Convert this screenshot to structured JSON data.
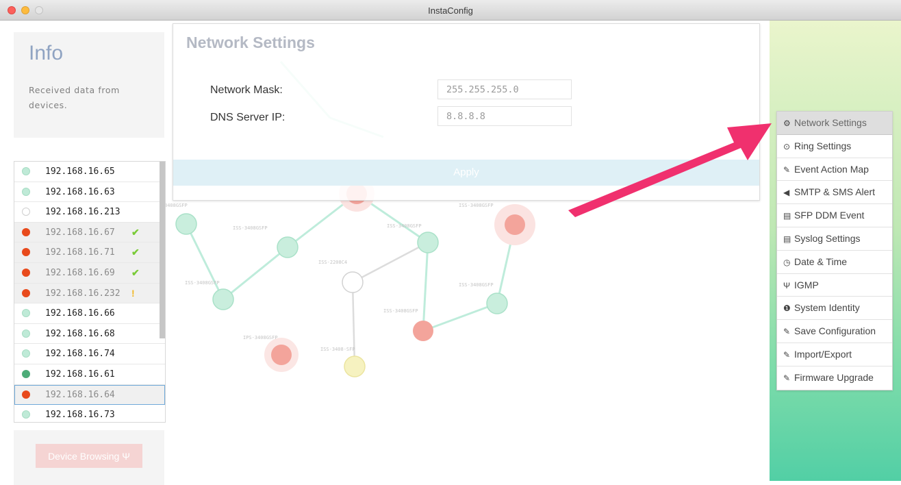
{
  "window": {
    "title": "InstaConfig"
  },
  "info": {
    "title": "Info",
    "text": "Received data from devices."
  },
  "devices": [
    {
      "ip": "192.168.16.65",
      "status_color": "green",
      "dimmed": false,
      "badge": ""
    },
    {
      "ip": "192.168.16.63",
      "status_color": "green",
      "dimmed": false,
      "badge": ""
    },
    {
      "ip": "192.168.16.213",
      "status_color": "empty",
      "dimmed": false,
      "badge": ""
    },
    {
      "ip": "192.168.16.67",
      "status_color": "red",
      "dimmed": true,
      "badge": "check"
    },
    {
      "ip": "192.168.16.71",
      "status_color": "red",
      "dimmed": true,
      "badge": "check"
    },
    {
      "ip": "192.168.16.69",
      "status_color": "red",
      "dimmed": true,
      "badge": "check"
    },
    {
      "ip": "192.168.16.232",
      "status_color": "red",
      "dimmed": true,
      "badge": "warning"
    },
    {
      "ip": "192.168.16.66",
      "status_color": "green",
      "dimmed": false,
      "badge": ""
    },
    {
      "ip": "192.168.16.68",
      "status_color": "green",
      "dimmed": false,
      "badge": ""
    },
    {
      "ip": "192.168.16.74",
      "status_color": "green",
      "dimmed": false,
      "badge": ""
    },
    {
      "ip": "192.168.16.61",
      "status_color": "darkgreen",
      "dimmed": false,
      "badge": ""
    },
    {
      "ip": "192.168.16.64",
      "status_color": "red",
      "dimmed": true,
      "badge": "",
      "selected": true
    },
    {
      "ip": "192.168.16.73",
      "status_color": "green",
      "dimmed": false,
      "badge": ""
    }
  ],
  "device_browsing": {
    "label": "Device Browsing",
    "icon": "sitemap-icon"
  },
  "network_settings": {
    "title": "Network Settings",
    "mask_label": "Network Mask:",
    "mask_value": "255.255.255.0",
    "dns_label": "DNS Server IP:",
    "dns_value": "8.8.8.8",
    "apply_label": "Apply"
  },
  "menu": [
    {
      "icon": "⚙",
      "label": "Network Settings",
      "active": true
    },
    {
      "icon": "⊙",
      "label": "Ring Settings"
    },
    {
      "icon": "✎",
      "label": "Event Action Map"
    },
    {
      "icon": "◀",
      "label": "SMTP & SMS Alert"
    },
    {
      "icon": "▤",
      "label": "SFP DDM Event"
    },
    {
      "icon": "▤",
      "label": "Syslog Settings"
    },
    {
      "icon": "◷",
      "label": "Date & Time"
    },
    {
      "icon": "Ψ",
      "label": "IGMP"
    },
    {
      "icon": "❶",
      "label": "System Identity"
    },
    {
      "icon": "✎",
      "label": "Save Configuration"
    },
    {
      "icon": "✎",
      "label": "Import/Export"
    },
    {
      "icon": "✎",
      "label": "Firmware Upgrade"
    }
  ],
  "colors": {
    "accent_arrow": "#f0306e",
    "node_green": "#bfead7",
    "node_red": "#f08f85",
    "node_yellow": "#f4f0b2"
  }
}
